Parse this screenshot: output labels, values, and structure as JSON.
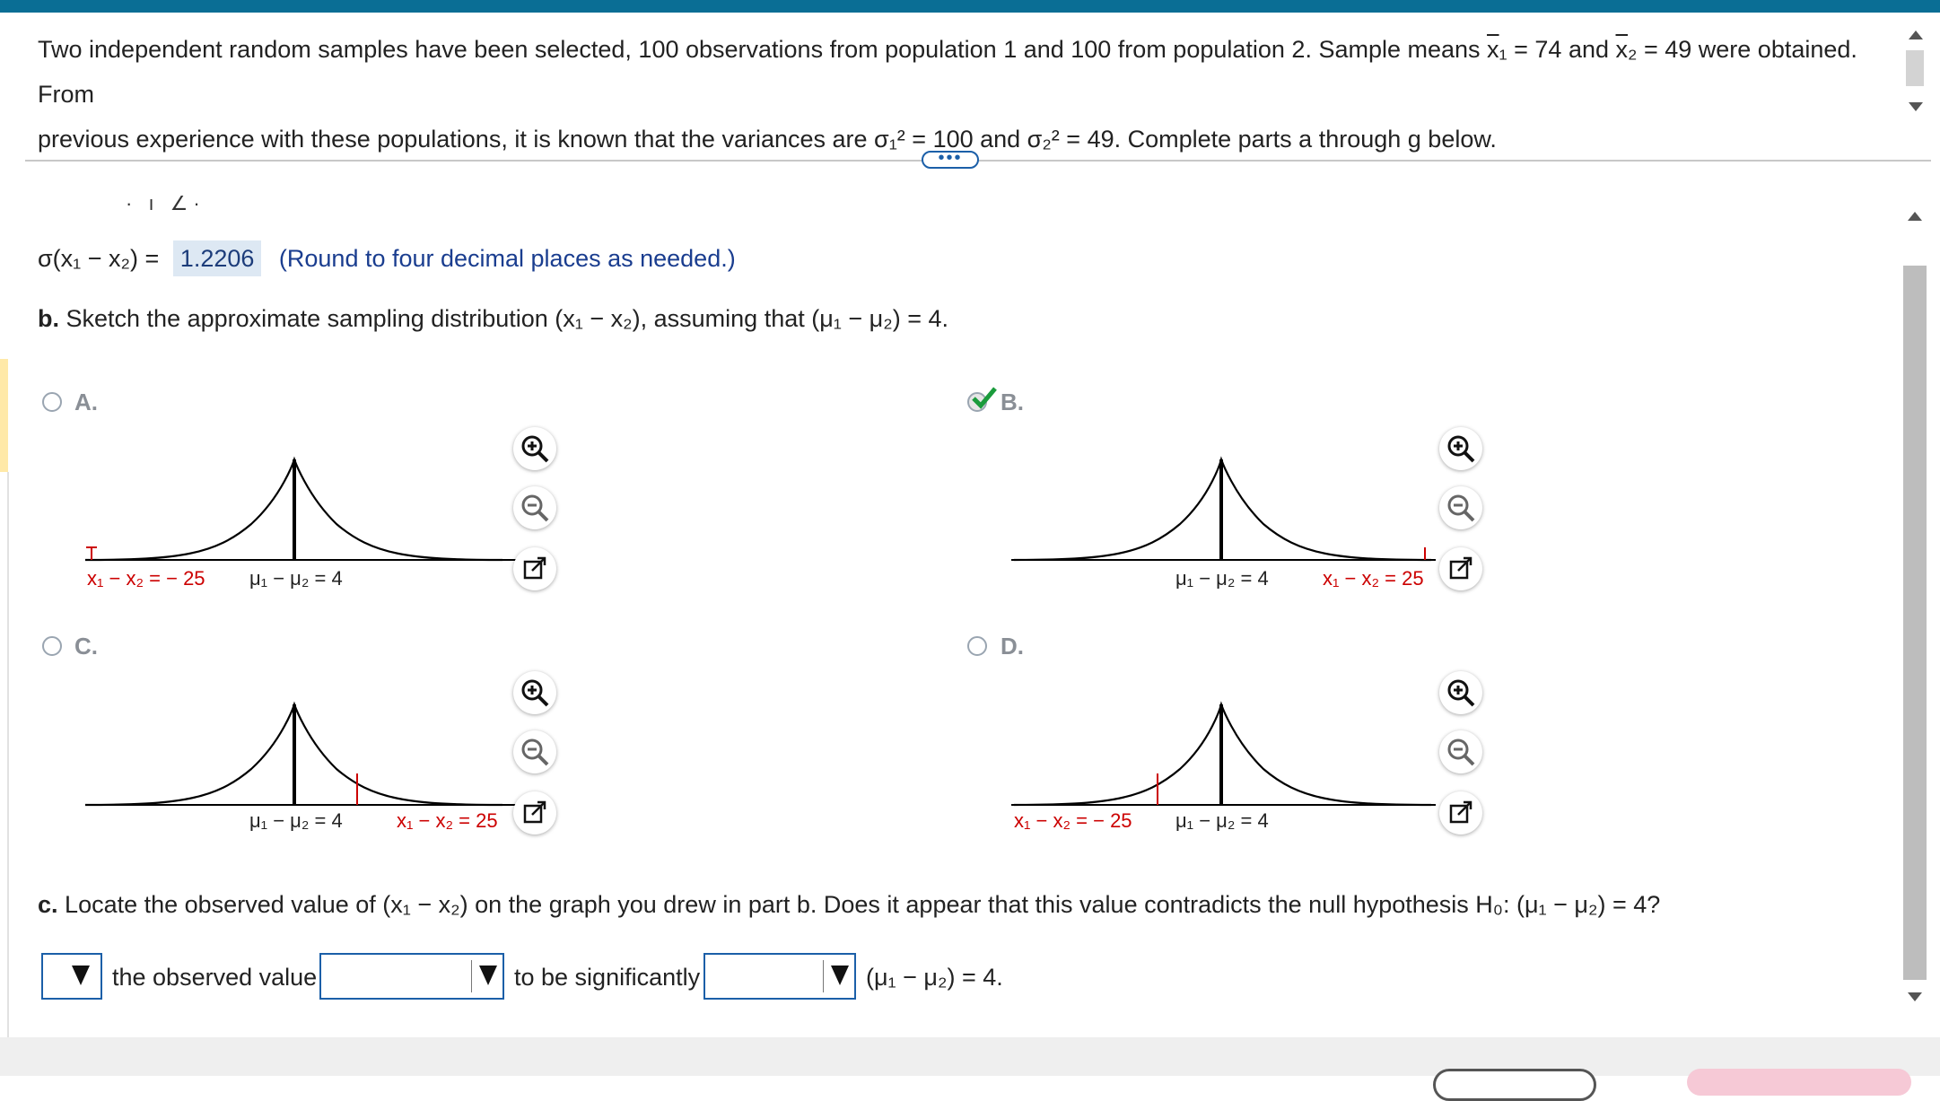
{
  "question": {
    "line1_a": "Two independent random samples have been selected, 100 observations from population 1 and 100 from population 2. Sample means ",
    "line1_x1": "x",
    "line1_b": "₁ = 74 and ",
    "line1_x2": "x",
    "line1_c": "₂ = 49 were obtained. From",
    "line2": "previous experience with these populations, it is known that the variances are σ₁² = 100 and σ₂² = 49. Complete parts a through g below."
  },
  "more_button": "•••",
  "part_a": {
    "label": "σ(x₁ − x₂) =",
    "answer": "1.2206",
    "hint": "(Round to four decimal places as needed.)"
  },
  "part_b": {
    "bold": "b.",
    "text": "Sketch the approximate sampling distribution (x₁ − x₂), assuming that (μ₁ − μ₂) = 4."
  },
  "options": [
    {
      "letter": "A.",
      "mean_label": "μ₁ − μ₂ = 4",
      "marker_label": "x₁ − x₂ = − 25",
      "selected": false
    },
    {
      "letter": "B.",
      "mean_label": "μ₁ − μ₂ = 4",
      "marker_label": "x₁ − x₂ = 25",
      "selected": true
    },
    {
      "letter": "C.",
      "mean_label": "μ₁ − μ₂ = 4",
      "marker_label": "x₁ − x₂ = 25",
      "selected": false
    },
    {
      "letter": "D.",
      "mean_label": "μ₁ − μ₂ = 4",
      "marker_label": "x₁ − x₂ = − 25",
      "selected": false
    }
  ],
  "part_c": {
    "bold": "c.",
    "text": "Locate the observed value of (x₁ − x₂) on the graph you drew in part b. Does it appear that this value contradicts the null hypothesis H₀: (μ₁ − μ₂) = 4?"
  },
  "answer_row": {
    "text1": "the observed value",
    "text2": "to be significantly",
    "text3": "(μ₁ − μ₂) = 4."
  },
  "icons": {
    "zoom_in": "zoom-in-icon",
    "zoom_out": "zoom-out-icon",
    "popout": "popout-icon",
    "check": "checkmark-icon"
  },
  "colors": {
    "accent": "#0a6e95",
    "check": "#1a9b3c",
    "marker": "#cc0000",
    "answer_bg": "#dde8f3"
  }
}
